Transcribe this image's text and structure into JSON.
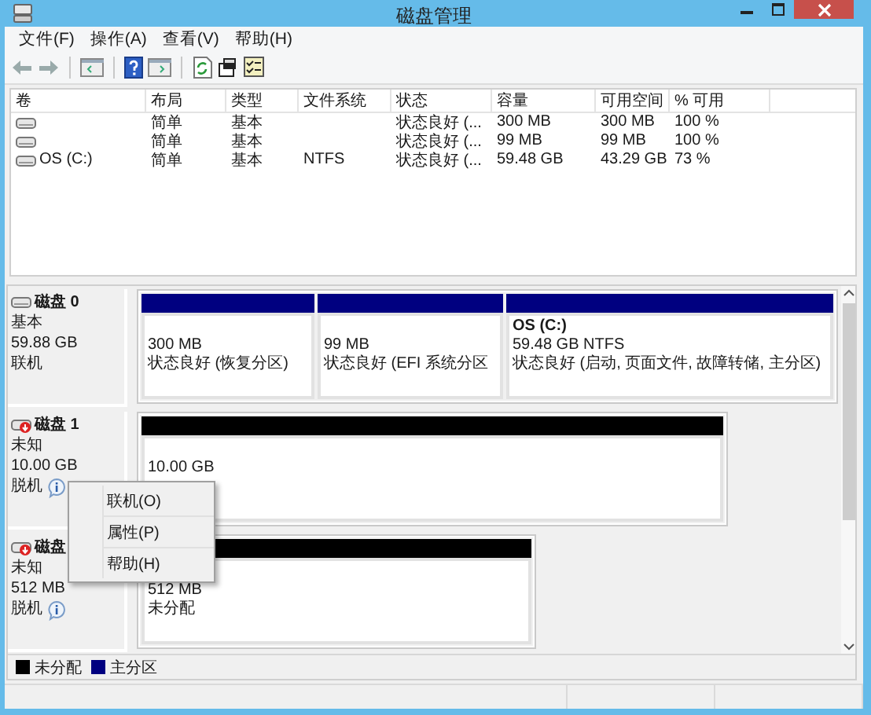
{
  "window": {
    "title": "磁盘管理"
  },
  "menu": [
    "文件(F)",
    "操作(A)",
    "查看(V)",
    "帮助(H)"
  ],
  "volume_table": {
    "columns": [
      "卷",
      "布局",
      "类型",
      "文件系统",
      "状态",
      "容量",
      "可用空间",
      "% 可用"
    ],
    "rows": [
      {
        "layout": "简单",
        "type": "基本",
        "status": "状态良好 (...",
        "capacity": "300 MB",
        "free": "300 MB",
        "percent": "100 %"
      },
      {
        "layout": "简单",
        "type": "基本",
        "status": "状态良好 (...",
        "capacity": "99 MB",
        "free": "99 MB",
        "percent": "100 %"
      },
      {
        "volume": "OS (C:)",
        "layout": "简单",
        "type": "基本",
        "filesystem": "NTFS",
        "status": "状态良好 (...",
        "capacity": "59.48 GB",
        "free": "43.29 GB",
        "percent": "73 %"
      }
    ]
  },
  "disks": [
    {
      "name": "磁盘 0",
      "type": "基本",
      "size": "59.88 GB",
      "status": "联机",
      "offline": false,
      "partitions": [
        {
          "size": "300 MB",
          "status": "状态良好 (恢复分区)",
          "color": "#000080"
        },
        {
          "size": "99 MB",
          "status": "状态良好 (EFI 系统分区",
          "color": "#000080"
        },
        {
          "title": "OS  (C:)",
          "size": "59.48 GB NTFS",
          "status": "状态良好 (启动, 页面文件, 故障转储, 主分区)",
          "color": "#000080"
        }
      ]
    },
    {
      "name": "磁盘 1",
      "type": "未知",
      "size": "10.00 GB",
      "status": "脱机",
      "offline": true,
      "partitions": [
        {
          "size": "10.00 GB",
          "color": "#000000"
        }
      ]
    },
    {
      "name": "磁盘",
      "type": "未知",
      "size": "512 MB",
      "status": "脱机",
      "offline": true,
      "partitions": [
        {
          "size": "512 MB",
          "status": "未分配",
          "color": "#000000"
        }
      ]
    }
  ],
  "legend": [
    {
      "label": "未分配",
      "color": "#000000"
    },
    {
      "label": "主分区",
      "color": "#000080"
    }
  ],
  "context_menu": [
    "联机(O)",
    "属性(P)",
    "帮助(H)"
  ]
}
